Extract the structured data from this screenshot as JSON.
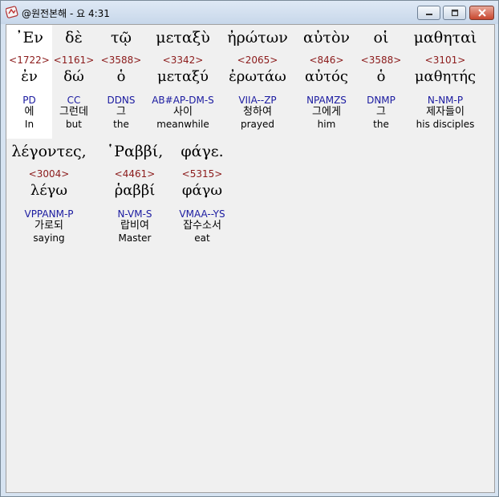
{
  "window": {
    "title": "@원전본해 - 요 4:31"
  },
  "icons": {
    "app": "app-icon",
    "min": "minimize-icon",
    "max": "maximize-icon",
    "close": "close-icon"
  },
  "colors": {
    "strong": "#8b1a1a",
    "parse": "#1a1aa0",
    "highlight": "#ffffff"
  },
  "lines": [
    {
      "words": [
        {
          "greek": "᾿Εν",
          "strong": "<1722>",
          "lemma": "ἐν",
          "parse": "PD",
          "korean": "에",
          "english": "In",
          "highlight": true
        },
        {
          "greek": "δὲ",
          "strong": "<1161>",
          "lemma": "δώ",
          "parse": "CC",
          "korean": "그런데",
          "english": "but"
        },
        {
          "greek": "τῷ",
          "strong": "<3588>",
          "lemma": "ὁ",
          "parse": "DDNS",
          "korean": "그",
          "english": "the"
        },
        {
          "greek": "μεταξὺ",
          "strong": "<3342>",
          "lemma": "μεταξύ",
          "parse": "AB#AP-DM-S",
          "korean": "사이",
          "english": "meanwhile"
        },
        {
          "greek": "ἠρώτων",
          "strong": "<2065>",
          "lemma": "ἐρωτάω",
          "parse": "VIIA--ZP",
          "korean": "청하여",
          "english": "prayed"
        },
        {
          "greek": "αὐτὸν",
          "strong": "<846>",
          "lemma": "αὐτός",
          "parse": "NPAMZS",
          "korean": "그에게",
          "english": "him"
        },
        {
          "greek": "οἱ",
          "strong": "<3588>",
          "lemma": "ὁ",
          "parse": "DNMP",
          "korean": "그",
          "english": "the"
        },
        {
          "greek": "μαθηταὶ",
          "strong": "<3101>",
          "lemma": "μαθητής",
          "parse": "N-NM-P",
          "korean": "제자들이",
          "english": "his disciples"
        }
      ]
    },
    {
      "words": [
        {
          "greek": "λέγοντες,",
          "strong": "<3004>",
          "lemma": "λέγω",
          "parse": "VPPANM-P",
          "korean": "가로되",
          "english": "saying"
        },
        {
          "greek": "῾Ραββί,",
          "strong": "<4461>",
          "lemma": "ῥαββί",
          "parse": "N-VM-S",
          "korean": "랍비여",
          "english": "Master"
        },
        {
          "greek": "φάγε.",
          "strong": "<5315>",
          "lemma": "φάγω",
          "parse": "VMAA--YS",
          "korean": "잡수소서",
          "english": "eat"
        }
      ]
    }
  ]
}
